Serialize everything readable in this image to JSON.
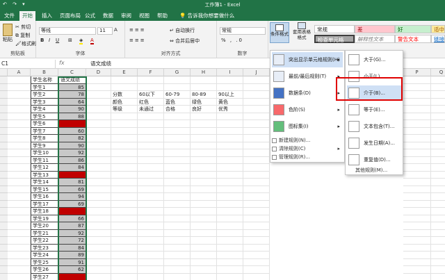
{
  "titlebar": {
    "title": "工作簿1 - Excel",
    "quick": "↶ ↷ ▾"
  },
  "tabs": [
    "文件",
    "开始",
    "插入",
    "页面布局",
    "公式",
    "数据",
    "审阅",
    "视图",
    "帮助",
    "告诉我你想要做什么"
  ],
  "ribbon": {
    "clipboard": {
      "paste": "粘贴",
      "cut": "剪切",
      "copy": "复制",
      "painter": "格式刷",
      "label": "剪贴板"
    },
    "font": {
      "name": "等线",
      "size": "11",
      "label": "字体",
      "bold": "B",
      "italic": "I",
      "underline": "U"
    },
    "align": {
      "wrap": "自动换行",
      "merge": "合并后居中",
      "label": "对齐方式"
    },
    "number": {
      "format": "常规",
      "label": "数字"
    },
    "styles": {
      "cond": "条件格式",
      "table": "套用表格格式",
      "normal": "常规",
      "bad": "差",
      "good": "好",
      "neutral": "适中",
      "check": "检查单元格",
      "explain": "解释性文本",
      "warn": "警告文本",
      "link": "链接"
    }
  },
  "formula_bar": {
    "namebox": "C1",
    "fx": "fx",
    "content": "语文成绩"
  },
  "sheet": {
    "columns": [
      "A",
      "B",
      "C",
      "D",
      "E",
      "F",
      "G",
      "H",
      "I",
      "J"
    ],
    "col_extra": [
      "P",
      "Q"
    ],
    "header_row": {
      "b": "学生名称",
      "c": "语文成绩"
    },
    "students": [
      {
        "name": "学生1",
        "score": "85"
      },
      {
        "name": "学生2",
        "score": "78"
      },
      {
        "name": "学生3",
        "score": "64"
      },
      {
        "name": "学生4",
        "score": "90"
      },
      {
        "name": "学生5",
        "score": "88"
      },
      {
        "name": "学生6",
        "score": ""
      },
      {
        "name": "学生7",
        "score": "60"
      },
      {
        "name": "学生8",
        "score": "82"
      },
      {
        "name": "学生9",
        "score": "90"
      },
      {
        "name": "学生10",
        "score": "92"
      },
      {
        "name": "学生11",
        "score": "86"
      },
      {
        "name": "学生12",
        "score": "84"
      },
      {
        "name": "学生13",
        "score": ""
      },
      {
        "name": "学生14",
        "score": "81"
      },
      {
        "name": "学生15",
        "score": "69"
      },
      {
        "name": "学生16",
        "score": "94"
      },
      {
        "name": "学生17",
        "score": "69"
      },
      {
        "name": "学生18",
        "score": ""
      },
      {
        "name": "学生19",
        "score": "66"
      },
      {
        "name": "学生20",
        "score": "87"
      },
      {
        "name": "学生21",
        "score": "92"
      },
      {
        "name": "学生22",
        "score": "72"
      },
      {
        "name": "学生23",
        "score": "84"
      },
      {
        "name": "学生24",
        "score": "89"
      },
      {
        "name": "学生25",
        "score": "91"
      },
      {
        "name": "学生26",
        "score": "62"
      },
      {
        "name": "学生27",
        "score": ""
      },
      {
        "name": "学生28",
        "score": ""
      }
    ],
    "legend": [
      [
        "分数",
        "60以下",
        "60-79",
        "80-89",
        "90以上"
      ],
      [
        "颜色",
        "红色",
        "蓝色",
        "绿色",
        "黄色"
      ],
      [
        "等级",
        "未通过",
        "合格",
        "良好",
        "优秀"
      ]
    ]
  },
  "cf_menu": {
    "items": [
      "突出显示单元格规则(H)",
      "最前/最后规则(T)",
      "数据条(D)",
      "色阶(S)",
      "图标集(I)"
    ],
    "small": [
      "新建规则(N)...",
      "清除规则(C)",
      "管理规则(R)..."
    ]
  },
  "sub_menu": {
    "items": [
      "大于(G)...",
      "小于(L)...",
      "介于(B)...",
      "等于(E)...",
      "文本包含(T)...",
      "发生日期(A)...",
      "重复值(D)..."
    ],
    "more": "其他规则(M)..."
  },
  "colors": {
    "green": "#217346",
    "red": "#c00000",
    "grey": "#c8c8c8",
    "highlight": "#e00000",
    "hover": "#cfe0f5"
  }
}
